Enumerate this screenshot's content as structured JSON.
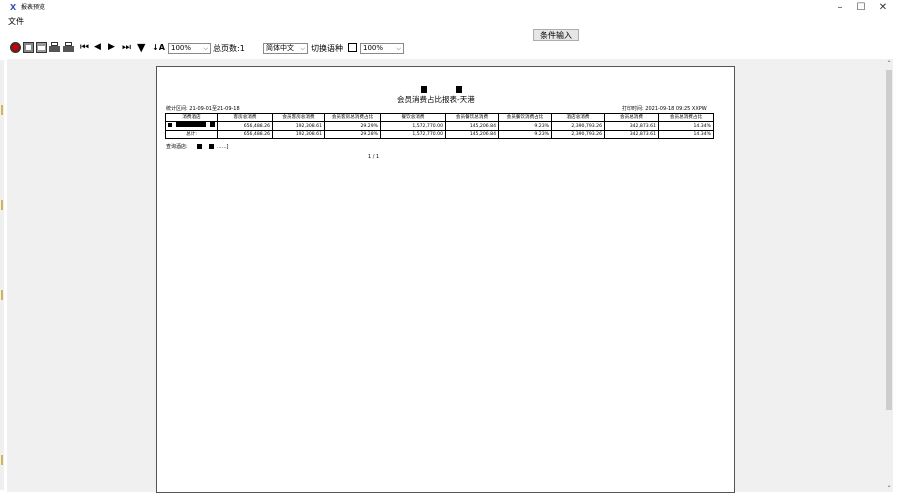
{
  "window": {
    "icon_text": "X",
    "title": "报表预览",
    "minimize": "–",
    "maximize": "☐",
    "close": "✕"
  },
  "menu": {
    "file": "文件"
  },
  "condition_button": "条件输入",
  "toolbar": {
    "zoom_value": "100%",
    "total_pages": "总页数:1",
    "language_value": "简体中文",
    "switch_language": "切换语种",
    "zoom2_value": "100%"
  },
  "report": {
    "title": "会员消费占比报表-天港",
    "period": "统计区间:  21-09-01至21-09-18",
    "print_time": "打印时间: 2021-09-18 09:25 XXPW",
    "columns": [
      "消费酒店",
      "客房总消费",
      "会员客房总消费",
      "会员客房总消费占比",
      "餐饮总消费",
      "会员餐饮总消费",
      "会员餐饮消费占比",
      "酒店总消费",
      "会员总消费",
      "会员总消费占比"
    ],
    "rows": [
      [
        "",
        "656,488.26",
        "192,308.61",
        "29.29%",
        "1,572,770.00",
        "145,206.84",
        "9.23%",
        "2,390,793.26",
        "342,873.61",
        "14.34%"
      ]
    ],
    "total_row": [
      "总计:",
      "656,488.26",
      "192,308.61",
      "29.28%",
      "1,572,770.00",
      "145,206.84",
      "9.23%",
      "2,390,793.26",
      "342,873.61",
      "14.34%"
    ],
    "query_label": "查询酒店:",
    "query_suffix": "......]",
    "page_indicator": "1 / 1"
  }
}
